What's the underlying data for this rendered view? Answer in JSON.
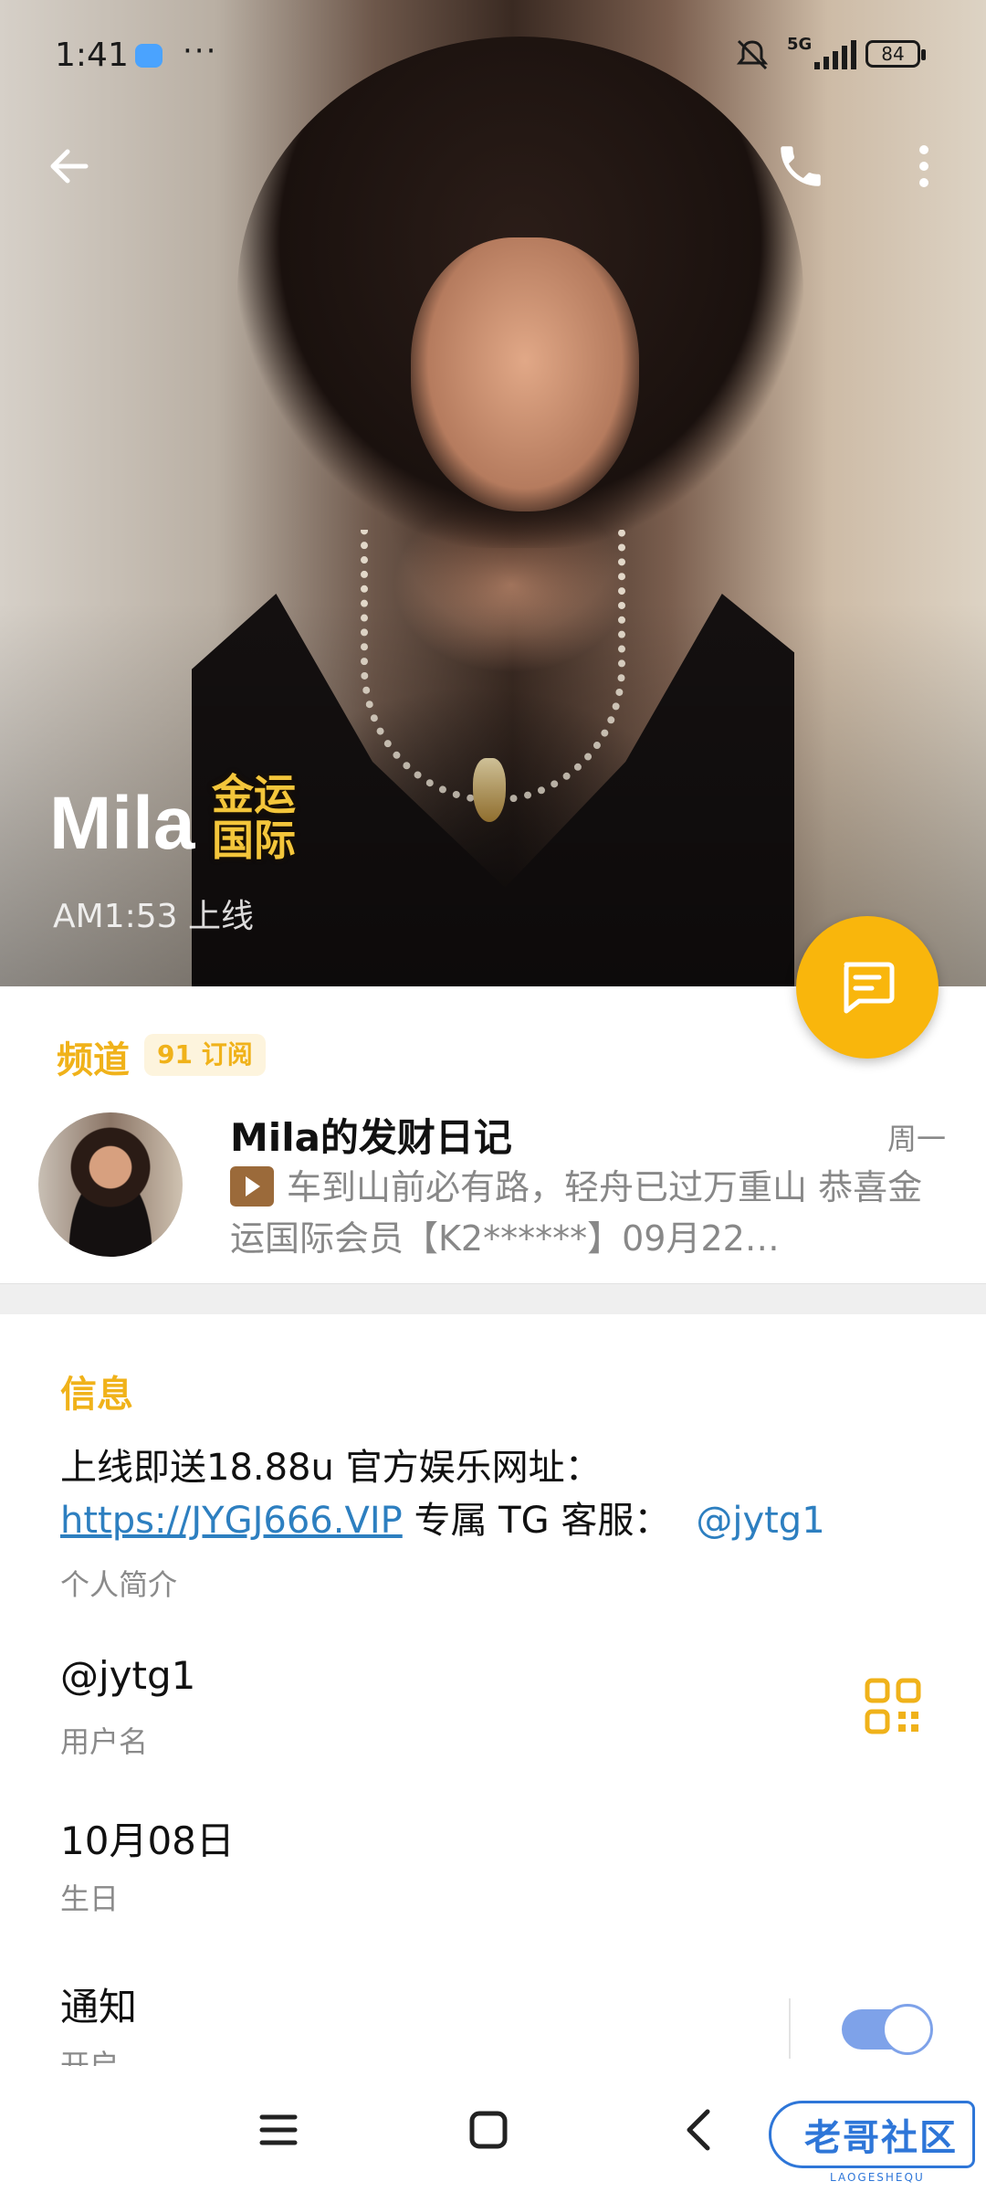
{
  "status_bar": {
    "time": "1:41",
    "overflow": "···",
    "network": "5G",
    "battery": "84"
  },
  "profile": {
    "name": "Mila",
    "badge_text": "金运国际",
    "last_seen": "AM1:53 上线"
  },
  "channel": {
    "section_label": "频道",
    "subscribers": "91 订阅",
    "title": "Mila的发财日记",
    "day": "周一",
    "preview": "车到山前必有路，轻舟已过万重山 恭喜金运国际会员【K2******】09月22…"
  },
  "info": {
    "section_label": "信息",
    "bio_line1": "上线即送18.88u 官方娱乐网址：",
    "bio_link": "https://JYGJ666.VIP",
    "bio_middle": " 专属 TG 客服：",
    "bio_mention": "@jytg1",
    "bio_caption": "个人简介",
    "username": "@jytg1",
    "username_caption": "用户名",
    "birthday": "10月08日",
    "birthday_caption": "生日",
    "notifications": "通知",
    "notifications_caption": "开启",
    "notifications_on": true
  },
  "watermark": {
    "text": "老哥社区",
    "sub": "LAOGESHEQU"
  },
  "colors": {
    "accent": "#f0b21a",
    "fab": "#f9b60c",
    "link": "#2d7fc0",
    "toggle": "#7ea2e9"
  },
  "icons": [
    "back-arrow-icon",
    "phone-icon",
    "more-vertical-icon",
    "message-icon",
    "qr-code-icon",
    "menu-icon",
    "home-square-icon",
    "nav-back-icon"
  ]
}
